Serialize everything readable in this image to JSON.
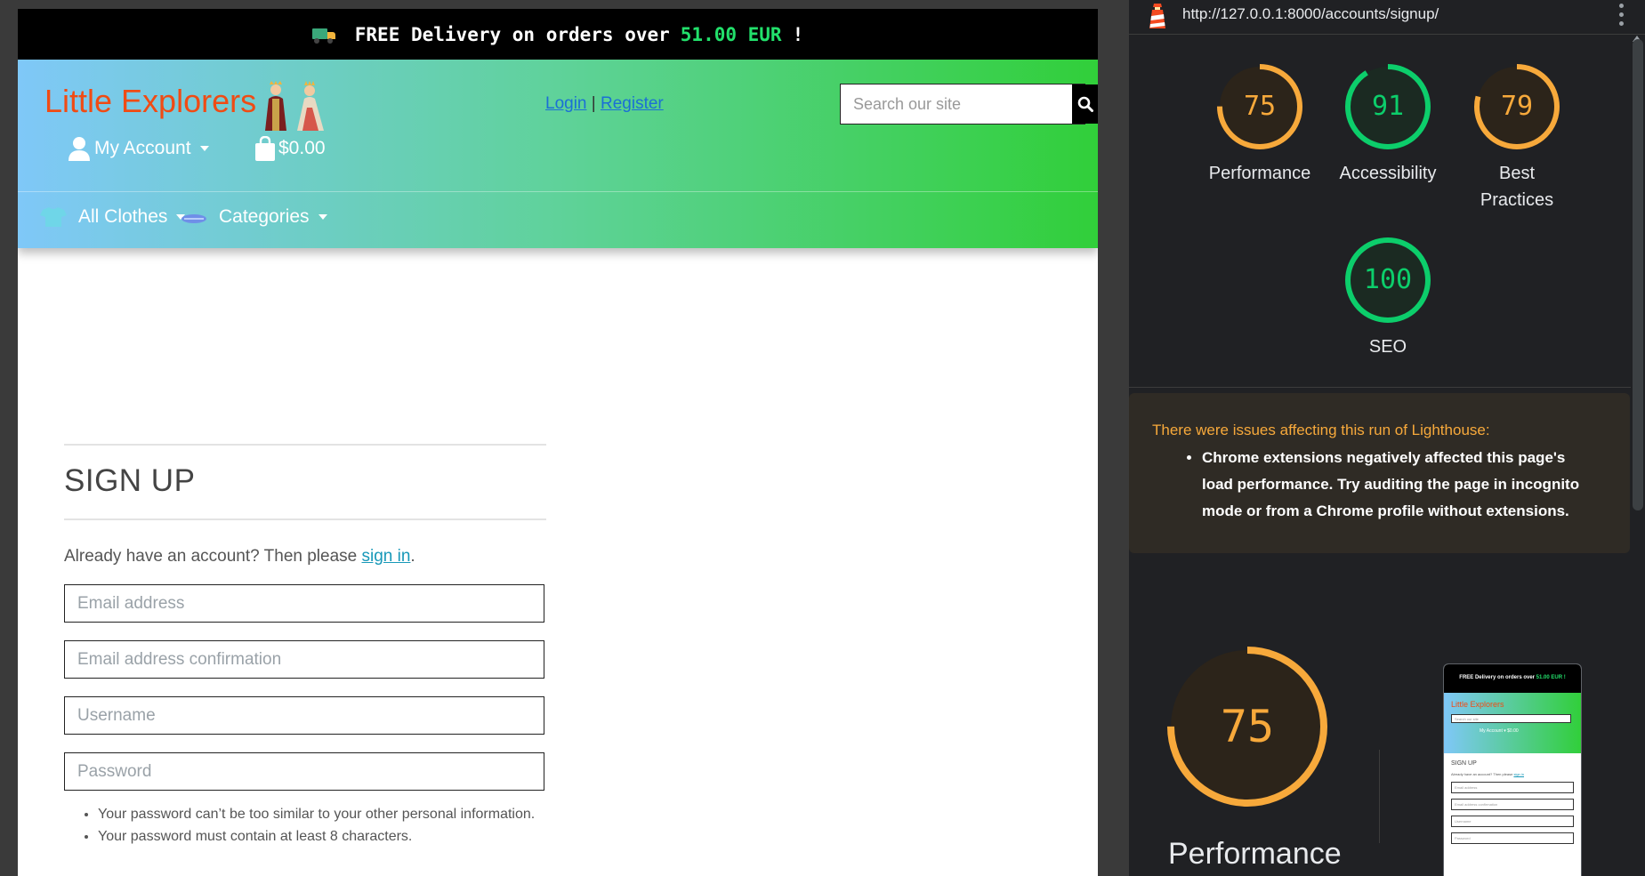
{
  "site": {
    "delivery": {
      "prefix": "FREE Delivery on orders over",
      "amount": "51.00 EUR",
      "suffix": "!"
    },
    "brand": "Little Explorers",
    "auth": {
      "login": "Login",
      "separator": "|",
      "register": "Register"
    },
    "search": {
      "placeholder": "Search our site"
    },
    "account": {
      "label": "My Account"
    },
    "cart": {
      "total": "$0.00"
    },
    "nav": [
      {
        "label": "All Clothes",
        "icon": "tshirt-icon"
      },
      {
        "label": "Categories",
        "icon": "sunglasses-icon"
      }
    ],
    "signup": {
      "heading": "SIGN UP",
      "already_text": "Already have an account? Then please",
      "signin_link": "sign in",
      "period": ".",
      "fields": {
        "email": "Email address",
        "email_confirm": "Email address confirmation",
        "username": "Username",
        "password": "Password"
      },
      "hints": [
        "Your password can’t be too similar to your other personal information.",
        "Your password must contain at least 8 characters."
      ]
    },
    "colors": {
      "brand": "#f04b14",
      "accent": "#22e06b",
      "link": "#1798b8"
    }
  },
  "lighthouse": {
    "url": "http://127.0.0.1:8000/accounts/signup/",
    "scores": [
      {
        "label": "Performance",
        "value": "75",
        "color": "#f7a93b",
        "fraction": 0.75
      },
      {
        "label": "Accessibility",
        "value": "91",
        "color": "#0cce6b",
        "fraction": 0.91
      },
      {
        "label": "Best Practices",
        "value": "79",
        "color": "#f7a93b",
        "fraction": 0.79
      },
      {
        "label": "SEO",
        "value": "100",
        "color": "#0cce6b",
        "fraction": 1.0
      }
    ],
    "warning": {
      "title": "There were issues affecting this run of Lighthouse:",
      "items": [
        "Chrome extensions negatively affected this page's load performance. Try auditing the page in incognito mode or from a Chrome profile without extensions."
      ]
    },
    "main": {
      "value": "75",
      "label": "Performance",
      "fraction": 0.75
    },
    "thumbnail": {
      "delivery_prefix": "FREE Delivery on orders over",
      "delivery_amount": "51.00 EUR !",
      "brand": "Little Explorers",
      "search": "Search our site",
      "account": "My Account ▾ $0.00",
      "heading": "SIGN UP",
      "already": "Already have an account? Then please",
      "signin": "sign in",
      "fields": [
        "Email address",
        "Email address confirmation",
        "Username",
        "Password"
      ]
    }
  }
}
